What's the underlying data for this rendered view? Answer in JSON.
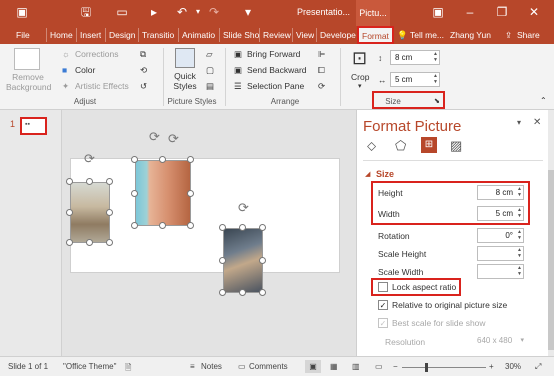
{
  "titlebar": {
    "doc_title": "Presentatio...",
    "contextual_tab": "Pictu...",
    "icons": [
      "save-icon",
      "start-from-beginning-icon",
      "undo-icon",
      "redo-icon",
      "customize-qat-icon",
      "ribbon-display-options-icon",
      "minimize-icon",
      "restore-icon",
      "close-icon"
    ]
  },
  "tabs": {
    "items": [
      "File",
      "Home",
      "Insert",
      "Design",
      "Transitio",
      "Animatio",
      "Slide Sho",
      "Review",
      "View",
      "Develope",
      "Format"
    ],
    "active": "Format",
    "tell_me": "Tell me...",
    "user": "Zhang Yun",
    "share": "Share"
  },
  "ribbon": {
    "remove_background": "Remove Background",
    "corrections": "Corrections",
    "color": "Color",
    "artistic_effects": "Artistic Effects",
    "adjust_group": "Adjust",
    "quick_styles": "Quick Styles",
    "picture_styles_group": "Picture Styles",
    "bring_forward": "Bring Forward",
    "send_backward": "Send Backward",
    "selection_pane": "Selection Pane",
    "arrange_group": "Arrange",
    "crop": "Crop",
    "height_value": "8 cm",
    "width_value": "5 cm",
    "size_group": "Size"
  },
  "thumbnails": {
    "slide_number": "1"
  },
  "format_pane": {
    "title": "Format Picture",
    "section": "Size",
    "height_label": "Height",
    "height_value": "8 cm",
    "width_label": "Width",
    "width_value": "5 cm",
    "rotation_label": "Rotation",
    "rotation_value": "0°",
    "scale_height_label": "Scale Height",
    "scale_width_label": "Scale Width",
    "lock_aspect_ratio": "Lock aspect ratio",
    "lock_aspect_checked": false,
    "relative_to_original": "Relative to original picture size",
    "relative_checked": true,
    "best_scale": "Best scale for slide show",
    "resolution_label": "Resolution",
    "resolution_value": "640 x 480"
  },
  "statusbar": {
    "slide_info": "Slide 1 of 1",
    "theme": "\"Office Theme\"",
    "notes": "Notes",
    "comments": "Comments",
    "zoom_minus": "−",
    "zoom_plus": "+",
    "zoom": "30%"
  },
  "colors": {
    "accent": "#b7472a",
    "highlight": "#d9231d",
    "pane_title": "#b7472a"
  }
}
